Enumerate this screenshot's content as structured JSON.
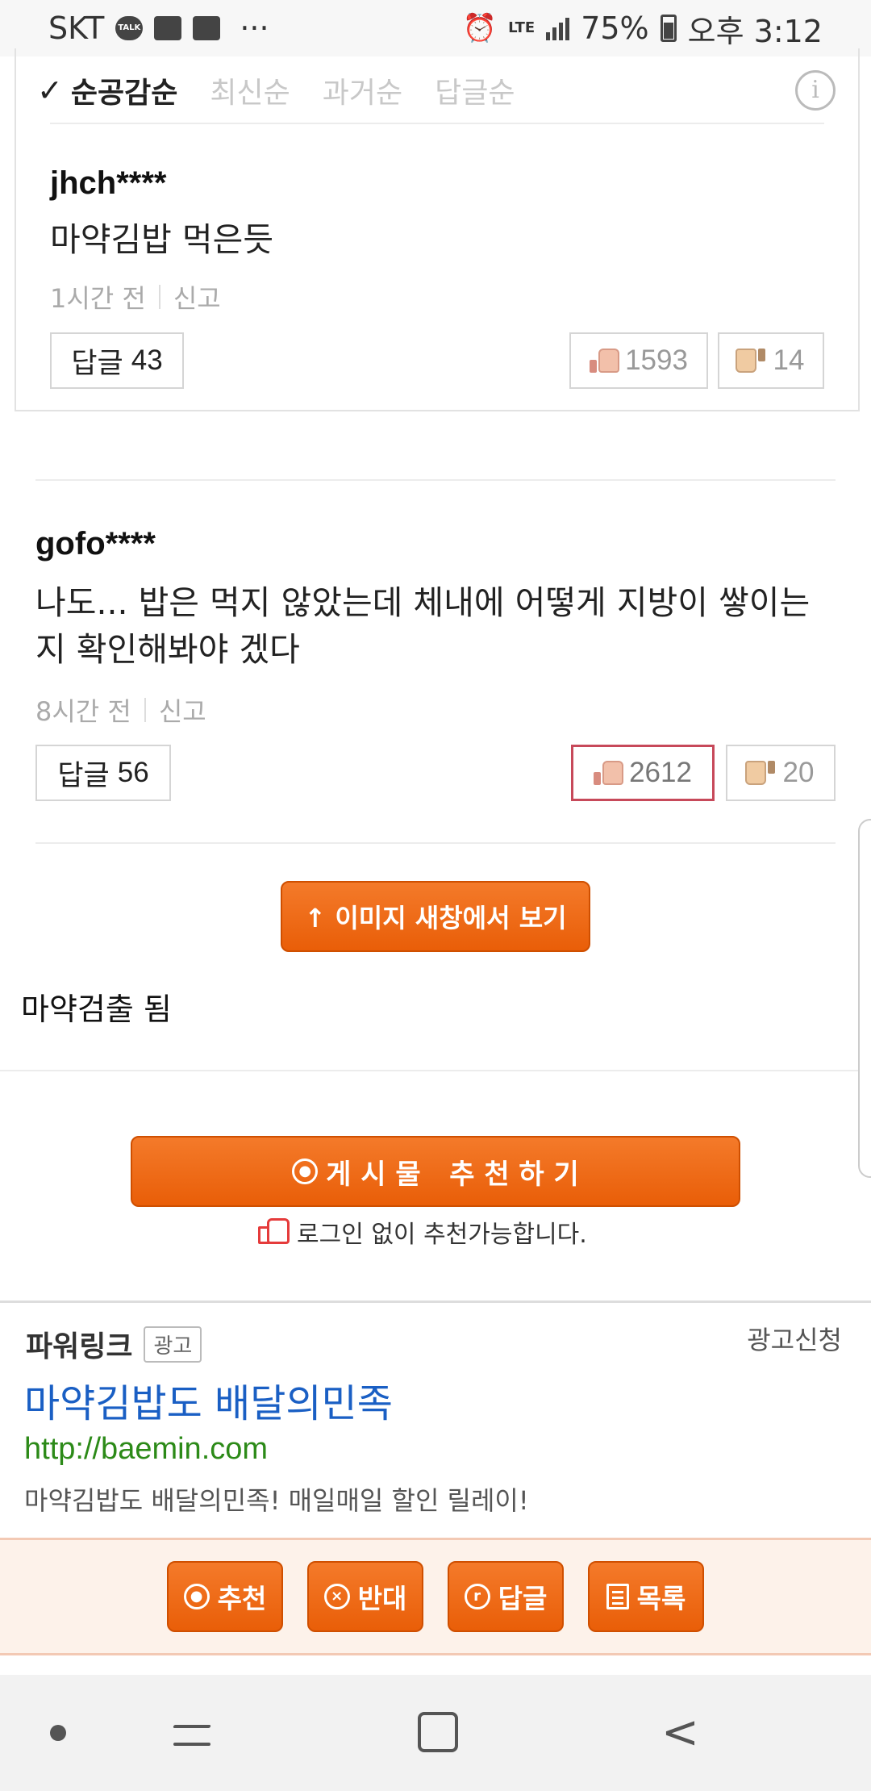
{
  "status_bar": {
    "carrier": "SKT",
    "talk_icon_label": "TALK",
    "lte_label": "LTE",
    "battery": "75%",
    "time": "오후 3:12",
    "dots": "···"
  },
  "sort": {
    "active": "순공감순",
    "options": [
      "최신순",
      "과거순",
      "답글순"
    ],
    "info_icon": "i"
  },
  "comments": [
    {
      "user": "jhch****",
      "text": "마약김밥 먹은듯",
      "time": "1시간 전",
      "report": "신고",
      "reply_label": "답글",
      "reply_count": "43",
      "likes": "1593",
      "dislikes": "14"
    },
    {
      "user": "gofo****",
      "text": "나도... 밥은 먹지 않았는데 체내에 어떻게 지방이 쌓이는지 확인해봐야 겠다",
      "time": "8시간 전",
      "report": "신고",
      "reply_label": "답글",
      "reply_count": "56",
      "likes": "2612",
      "dislikes": "20"
    }
  ],
  "view_image_button": "↑ 이미지 새창에서 보기",
  "body_text": "마약검출 됨",
  "recommend_button": "게 시 물   추 천 하 기",
  "recommend_hint": "로그인 없이 추천가능합니다.",
  "ad": {
    "section_title": "파워링크",
    "tag": "광고",
    "apply": "광고신청",
    "title": "마약김밥도 배달의민족",
    "url": "http://baemin.com",
    "description": "마약김밥도 배달의민족! 매일매일 할인 릴레이!"
  },
  "actions": [
    {
      "icon": "◎",
      "label": "추천"
    },
    {
      "icon": "⊗",
      "label": "반대"
    },
    {
      "icon": "r",
      "label": "답글"
    },
    {
      "icon": "list",
      "label": "목록"
    }
  ],
  "colors": {
    "accent_orange": "#ee6a14",
    "link_blue": "#1a5fc4",
    "url_green": "#2c8a18",
    "highlight_border": "#c7495a"
  }
}
